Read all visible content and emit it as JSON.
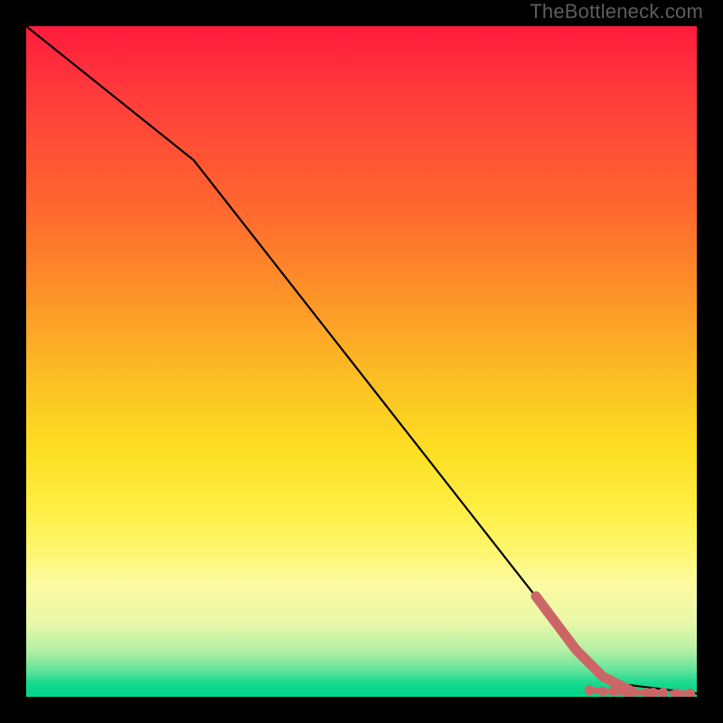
{
  "colors": {
    "page_bg": "#000000",
    "watermark": "#5d5d5d",
    "curve": "#000000",
    "dots": "#cc6666",
    "dot_border": "#8a3f3f"
  },
  "watermark": {
    "text": "TheBottleneck.com"
  },
  "chart_data": {
    "type": "line",
    "title": "",
    "xlabel": "",
    "ylabel": "",
    "x_range": [
      0,
      100
    ],
    "y_range": [
      0,
      100
    ],
    "note": "Axes carry no ticks or labels in the rendered image; values below are estimated pixel-proportional percentages.",
    "curve": {
      "name": "bottleneck curve",
      "points": [
        {
          "x": 0,
          "y": 100
        },
        {
          "x": 25,
          "y": 80
        },
        {
          "x": 83,
          "y": 6
        },
        {
          "x": 88,
          "y": 2
        },
        {
          "x": 100,
          "y": 0.5
        }
      ]
    },
    "highlight_segment": {
      "name": "thick salmon overlay",
      "points": [
        {
          "x": 76,
          "y": 15
        },
        {
          "x": 82,
          "y": 7
        },
        {
          "x": 86,
          "y": 3
        },
        {
          "x": 90,
          "y": 1
        }
      ]
    },
    "scatter": {
      "name": "bottom dots (salmon)",
      "points": [
        {
          "x": 84,
          "y": 1.0
        },
        {
          "x": 86,
          "y": 0.8
        },
        {
          "x": 87.5,
          "y": 0.8
        },
        {
          "x": 89.5,
          "y": 0.7
        },
        {
          "x": 90.5,
          "y": 0.7
        },
        {
          "x": 92.5,
          "y": 0.6
        },
        {
          "x": 93.5,
          "y": 0.6
        },
        {
          "x": 95,
          "y": 0.6
        },
        {
          "x": 97,
          "y": 0.5
        },
        {
          "x": 99,
          "y": 0.5
        }
      ]
    }
  }
}
